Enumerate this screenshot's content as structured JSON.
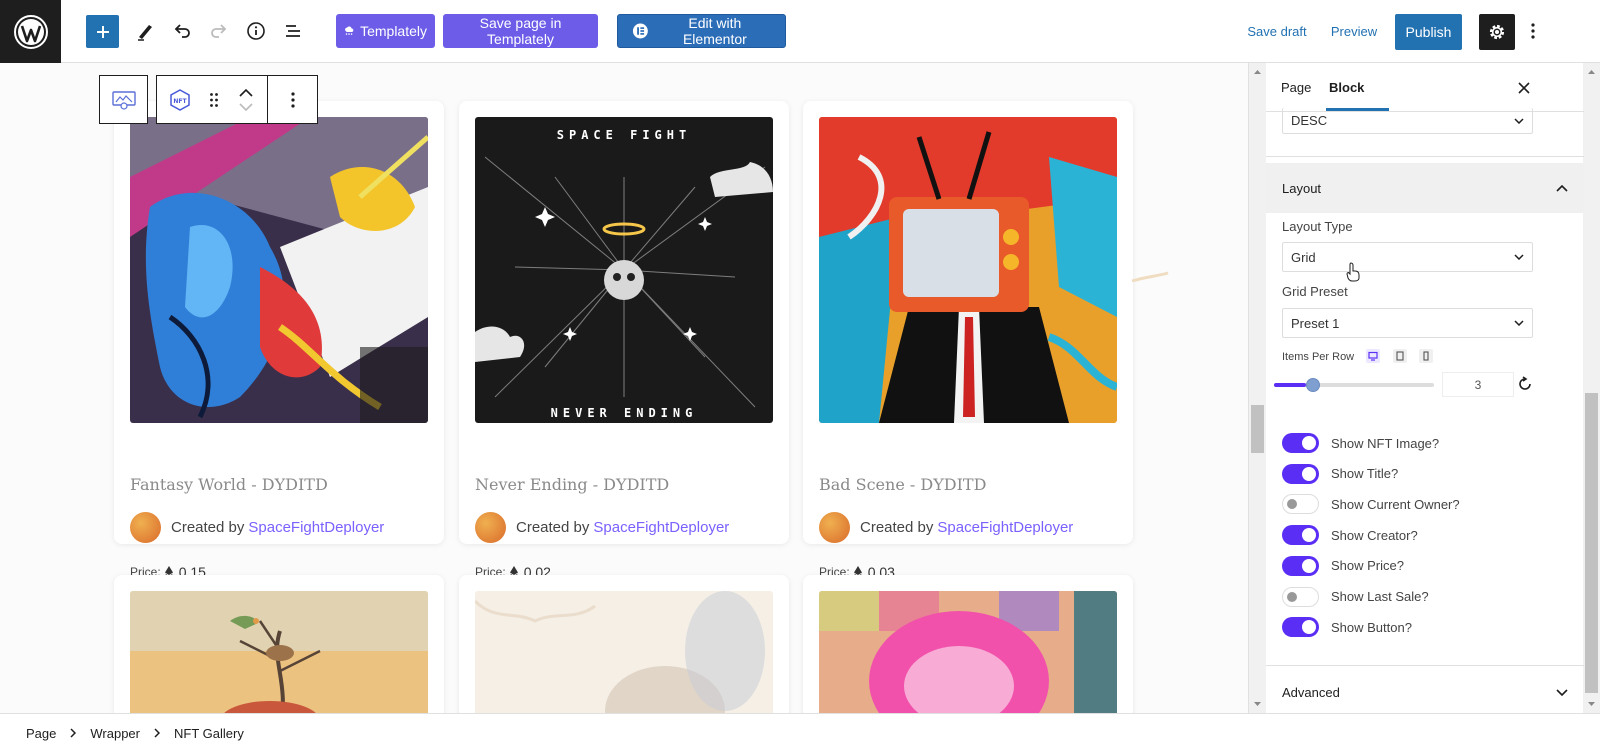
{
  "toolbar": {
    "templately_label": "Templately",
    "save_templately_label": "Save page in Templately",
    "elementor_label": "Edit with Elementor",
    "save_draft_label": "Save draft",
    "preview_label": "Preview",
    "publish_label": "Publish"
  },
  "cards": [
    {
      "title": "Fantasy World - DYDITD",
      "created_by": "Created by",
      "creator": "SpaceFightDeployer",
      "price_label": "Price:",
      "price": "0.15"
    },
    {
      "title": "Never Ending - DYDITD",
      "created_by": "Created by",
      "creator": "SpaceFightDeployer",
      "price_label": "Price:",
      "price": "0.02"
    },
    {
      "title": "Bad Scene - DYDITD",
      "created_by": "Created by",
      "creator": "SpaceFightDeployer",
      "price_label": "Price:",
      "price": "0.03"
    }
  ],
  "art_text": {
    "space_fight": "SPACE FIGHT",
    "never_ending": "NEVER ENDING"
  },
  "sidebar": {
    "tab_page": "Page",
    "tab_block": "Block",
    "order_value": "DESC",
    "layout_title": "Layout",
    "layout_type_label": "Layout Type",
    "layout_type_value": "Grid",
    "grid_preset_label": "Grid Preset",
    "grid_preset_value": "Preset 1",
    "items_per_row_label": "Items Per Row",
    "items_per_row_value": "3",
    "items_per_row_fraction": 0.2,
    "toggles": [
      {
        "label": "Show NFT Image?",
        "on": true
      },
      {
        "label": "Show Title?",
        "on": true
      },
      {
        "label": "Show Current Owner?",
        "on": false
      },
      {
        "label": "Show Creator?",
        "on": true
      },
      {
        "label": "Show Price?",
        "on": true
      },
      {
        "label": "Show Last Sale?",
        "on": false
      },
      {
        "label": "Show Button?",
        "on": true
      }
    ],
    "advanced_title": "Advanced"
  },
  "breadcrumb": [
    "Page",
    "Wrapper",
    "NFT Gallery"
  ],
  "colors": {
    "accent": "#2271b1",
    "toggle_on": "#5b2ef5",
    "templately": "#6c5ce7",
    "creator_link": "#7b61ff"
  }
}
